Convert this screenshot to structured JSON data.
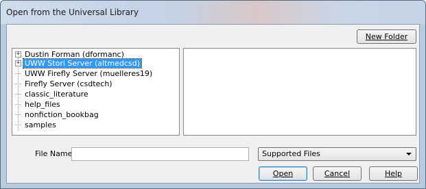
{
  "window": {
    "title": "Open from the Universal Library"
  },
  "toolbar": {
    "new_folder_label": "New Folder"
  },
  "tree": {
    "items": [
      {
        "label": "Dustin Forman (dformanc)",
        "expandable": true,
        "selected": false
      },
      {
        "label": "UWW Stori Server (altmedcsd)",
        "expandable": true,
        "selected": true
      },
      {
        "label": "UWW Firefly Server (muelleres19)",
        "expandable": false,
        "selected": false
      },
      {
        "label": "Firefly Server (csdtech)",
        "expandable": false,
        "selected": false
      },
      {
        "label": "classic_literature",
        "expandable": false,
        "selected": false
      },
      {
        "label": "help_files",
        "expandable": false,
        "selected": false
      },
      {
        "label": "nonfiction_bookbag",
        "expandable": false,
        "selected": false
      },
      {
        "label": "samples",
        "expandable": false,
        "selected": false
      }
    ]
  },
  "form": {
    "file_name_label": "File Name:",
    "file_name_value": "",
    "file_type_selected": "Supported Files"
  },
  "buttons": {
    "open": "Open",
    "cancel": "Cancel",
    "help": "Help"
  },
  "icons": {
    "expand": "plus-icon",
    "dropdown": "chevron-down-icon"
  }
}
